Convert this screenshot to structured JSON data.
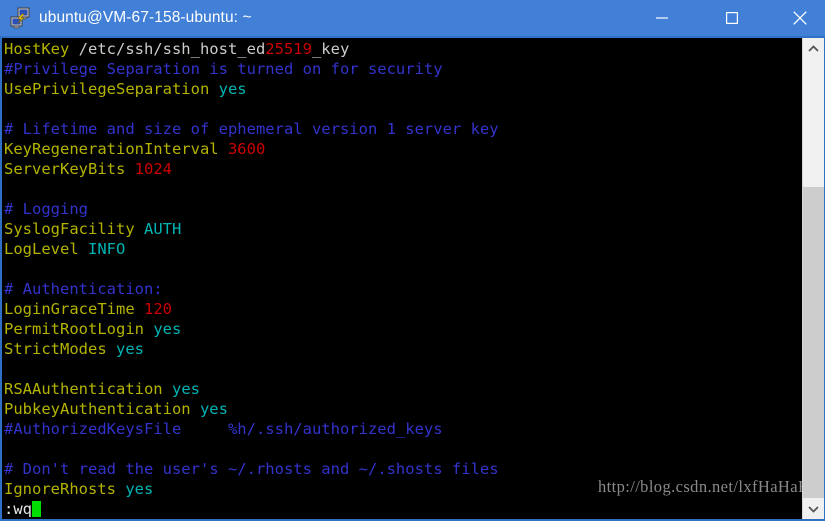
{
  "window": {
    "title": "ubuntu@VM-67-158-ubuntu: ~",
    "icon": "putty-icon",
    "titlebar_color": "#4180d6",
    "controls": {
      "minimize": "minimize-button",
      "maximize": "maximize-button",
      "close": "close-button"
    }
  },
  "terminal": {
    "background": "#000000",
    "colors": {
      "keyword": "#b3b300",
      "comment": "#3333cc",
      "number": "#cc0000",
      "value": "#00b3b3",
      "path": "#cccccc",
      "cursor": "#00dd00"
    },
    "lines": [
      {
        "id": "line-1",
        "segments": [
          {
            "t": "HostKey ",
            "c": "key"
          },
          {
            "t": "/etc/ssh/ssh_host_ed",
            "c": "path"
          },
          {
            "t": "25519",
            "c": "num"
          },
          {
            "t": "_key",
            "c": "path"
          }
        ]
      },
      {
        "id": "line-2",
        "segments": [
          {
            "t": "#Privilege Separation is turned on for security",
            "c": "comment"
          }
        ]
      },
      {
        "id": "line-3",
        "segments": [
          {
            "t": "UsePrivilegeSeparation ",
            "c": "key"
          },
          {
            "t": "yes",
            "c": "val"
          }
        ]
      },
      {
        "id": "line-4",
        "segments": [
          {
            "t": "",
            "c": "plain"
          }
        ]
      },
      {
        "id": "line-5",
        "segments": [
          {
            "t": "# Lifetime and size of ephemeral version 1 server key",
            "c": "comment"
          }
        ]
      },
      {
        "id": "line-6",
        "segments": [
          {
            "t": "KeyRegenerationInterval ",
            "c": "key"
          },
          {
            "t": "3600",
            "c": "num"
          }
        ]
      },
      {
        "id": "line-7",
        "segments": [
          {
            "t": "ServerKeyBits ",
            "c": "key"
          },
          {
            "t": "1024",
            "c": "num"
          }
        ]
      },
      {
        "id": "line-8",
        "segments": [
          {
            "t": "",
            "c": "plain"
          }
        ]
      },
      {
        "id": "line-9",
        "segments": [
          {
            "t": "# Logging",
            "c": "comment"
          }
        ]
      },
      {
        "id": "line-10",
        "segments": [
          {
            "t": "SyslogFacility ",
            "c": "key"
          },
          {
            "t": "AUTH",
            "c": "val"
          }
        ]
      },
      {
        "id": "line-11",
        "segments": [
          {
            "t": "LogLevel ",
            "c": "key"
          },
          {
            "t": "INFO",
            "c": "val"
          }
        ]
      },
      {
        "id": "line-12",
        "segments": [
          {
            "t": "",
            "c": "plain"
          }
        ]
      },
      {
        "id": "line-13",
        "segments": [
          {
            "t": "# Authentication:",
            "c": "comment"
          }
        ]
      },
      {
        "id": "line-14",
        "segments": [
          {
            "t": "LoginGraceTime ",
            "c": "key"
          },
          {
            "t": "120",
            "c": "num"
          }
        ]
      },
      {
        "id": "line-15",
        "segments": [
          {
            "t": "PermitRootLogin ",
            "c": "key"
          },
          {
            "t": "yes",
            "c": "val"
          }
        ]
      },
      {
        "id": "line-16",
        "segments": [
          {
            "t": "StrictModes ",
            "c": "key"
          },
          {
            "t": "yes",
            "c": "val"
          }
        ]
      },
      {
        "id": "line-17",
        "segments": [
          {
            "t": "",
            "c": "plain"
          }
        ]
      },
      {
        "id": "line-18",
        "segments": [
          {
            "t": "RSAAuthentication ",
            "c": "key"
          },
          {
            "t": "yes",
            "c": "val"
          }
        ]
      },
      {
        "id": "line-19",
        "segments": [
          {
            "t": "PubkeyAuthentication ",
            "c": "key"
          },
          {
            "t": "yes",
            "c": "val"
          }
        ]
      },
      {
        "id": "line-20",
        "segments": [
          {
            "t": "#AuthorizedKeysFile     %h/.ssh/authorized_keys",
            "c": "comment"
          }
        ]
      },
      {
        "id": "line-21",
        "segments": [
          {
            "t": "",
            "c": "plain"
          }
        ]
      },
      {
        "id": "line-22",
        "segments": [
          {
            "t": "# Don't read the user's ~/.rhosts and ~/.shosts files",
            "c": "comment"
          }
        ]
      },
      {
        "id": "line-23",
        "segments": [
          {
            "t": "IgnoreRhosts ",
            "c": "key"
          },
          {
            "t": "yes",
            "c": "val"
          }
        ]
      }
    ],
    "command_line": {
      "prompt": ":wq",
      "cursor": "block-cursor"
    }
  },
  "watermark": {
    "text": "http://blog.csdn.net/lxfHaHaHa"
  },
  "scrollbar": {
    "up_arrow": "scroll-up-arrow",
    "down_arrow": "scroll-down-arrow",
    "thumb": "scroll-thumb"
  }
}
